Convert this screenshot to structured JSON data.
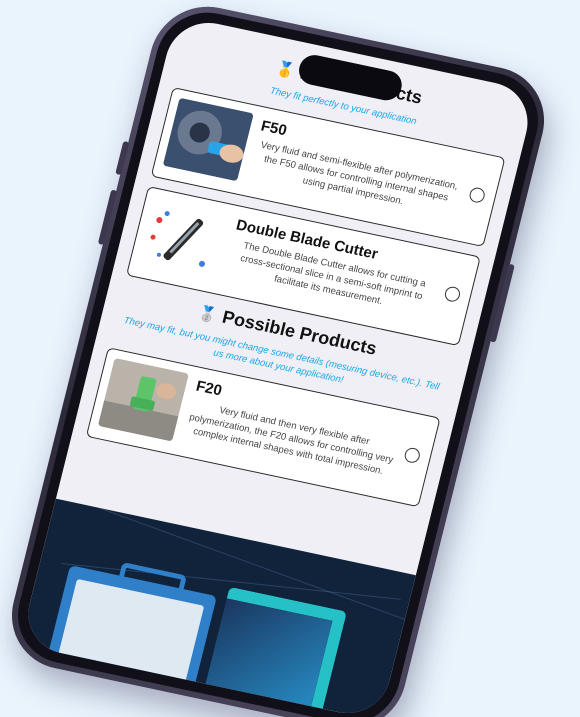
{
  "ideal_section": {
    "medal_icon": "gold-medal-icon",
    "title": "Ideal Products",
    "subtitle": "They fit perfectly to your application"
  },
  "ideal_products": [
    {
      "name": "F50",
      "description": "Very fluid and semi-flexible after polymerization, the F50 allows for controlling internal shapes using partial impression.",
      "selected": false
    },
    {
      "name": "Double Blade Cutter",
      "description": "The Double Blade Cutter allows for cutting a cross-sectional slice in a semi-soft imprint to facilitate its measurement.",
      "selected": false
    }
  ],
  "possible_section": {
    "medal_icon": "silver-medal-icon",
    "title": "Possible Products",
    "subtitle": "They may fit, but you might change some details (mesuring device, etc.). Tell us more about your application!"
  },
  "possible_products": [
    {
      "name": "F20",
      "description": "Very fluid and then very flexible after polymerization, the F20 allows for controlling very complex internal shapes with total impression.",
      "selected": false
    }
  ],
  "colors": {
    "accent_subtitle": "#1aa6e8",
    "screen_bg": "#f1eff6",
    "footer_bg": "#10233a",
    "logo_teal": "#29d3d8"
  }
}
